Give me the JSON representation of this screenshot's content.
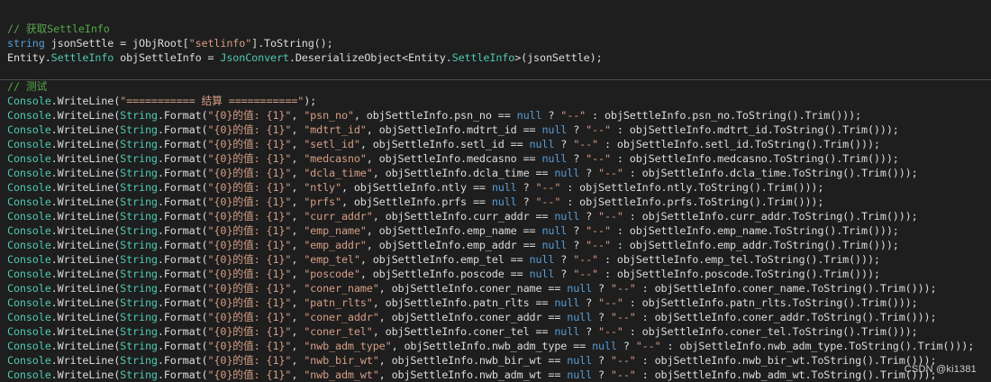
{
  "code_lines": [
    [
      [
        "comment",
        "// 获取SettleInfo"
      ]
    ],
    [
      [
        "kw",
        "string"
      ],
      [
        "plain",
        " jsonSettle = jObjRoot["
      ],
      [
        "str",
        "\"setlinfo\""
      ],
      [
        "plain",
        "].ToString();"
      ]
    ],
    [
      [
        "plain",
        "Entity."
      ],
      [
        "type",
        "SettleInfo"
      ],
      [
        "plain",
        " objSettleInfo = "
      ],
      [
        "type",
        "JsonConvert"
      ],
      [
        "plain",
        ".DeserializeObject<Entity."
      ],
      [
        "type",
        "SettleInfo"
      ],
      [
        "plain",
        ">(jsonSettle);"
      ]
    ],
    [
      [
        "plain",
        ""
      ]
    ],
    [
      [
        "comment",
        "// 测试"
      ]
    ],
    [
      [
        "type",
        "Console"
      ],
      [
        "plain",
        ".WriteLine("
      ],
      [
        "str",
        "\"=========== 结算 ===========\""
      ],
      [
        "plain",
        ");"
      ]
    ],
    [
      [
        "type",
        "Console"
      ],
      [
        "plain",
        ".WriteLine("
      ],
      [
        "type",
        "String"
      ],
      [
        "plain",
        ".Format("
      ],
      [
        "str",
        "\"{0}的值: {1}\""
      ],
      [
        "plain",
        ", "
      ],
      [
        "str",
        "\"psn_no\""
      ],
      [
        "plain",
        ", objSettleInfo.psn_no == "
      ],
      [
        "kw",
        "null"
      ],
      [
        "plain",
        " ? "
      ],
      [
        "str",
        "\"--\""
      ],
      [
        "plain",
        " : objSettleInfo.psn_no.ToString().Trim()));"
      ]
    ],
    [
      [
        "type",
        "Console"
      ],
      [
        "plain",
        ".WriteLine("
      ],
      [
        "type",
        "String"
      ],
      [
        "plain",
        ".Format("
      ],
      [
        "str",
        "\"{0}的值: {1}\""
      ],
      [
        "plain",
        ", "
      ],
      [
        "str",
        "\"mdtrt_id\""
      ],
      [
        "plain",
        ", objSettleInfo.mdtrt_id == "
      ],
      [
        "kw",
        "null"
      ],
      [
        "plain",
        " ? "
      ],
      [
        "str",
        "\"--\""
      ],
      [
        "plain",
        " : objSettleInfo.mdtrt_id.ToString().Trim()));"
      ]
    ],
    [
      [
        "type",
        "Console"
      ],
      [
        "plain",
        ".WriteLine("
      ],
      [
        "type",
        "String"
      ],
      [
        "plain",
        ".Format("
      ],
      [
        "str",
        "\"{0}的值: {1}\""
      ],
      [
        "plain",
        ", "
      ],
      [
        "str",
        "\"setl_id\""
      ],
      [
        "plain",
        ", objSettleInfo.setl_id == "
      ],
      [
        "kw",
        "null"
      ],
      [
        "plain",
        " ? "
      ],
      [
        "str",
        "\"--\""
      ],
      [
        "plain",
        " : objSettleInfo.setl_id.ToString().Trim()));"
      ]
    ],
    [
      [
        "type",
        "Console"
      ],
      [
        "plain",
        ".WriteLine("
      ],
      [
        "type",
        "String"
      ],
      [
        "plain",
        ".Format("
      ],
      [
        "str",
        "\"{0}的值: {1}\""
      ],
      [
        "plain",
        ", "
      ],
      [
        "str",
        "\"medcasno\""
      ],
      [
        "plain",
        ", objSettleInfo.medcasno == "
      ],
      [
        "kw",
        "null"
      ],
      [
        "plain",
        " ? "
      ],
      [
        "str",
        "\"--\""
      ],
      [
        "plain",
        " : objSettleInfo.medcasno.ToString().Trim()));"
      ]
    ],
    [
      [
        "type",
        "Console"
      ],
      [
        "plain",
        ".WriteLine("
      ],
      [
        "type",
        "String"
      ],
      [
        "plain",
        ".Format("
      ],
      [
        "str",
        "\"{0}的值: {1}\""
      ],
      [
        "plain",
        ", "
      ],
      [
        "str",
        "\"dcla_time\""
      ],
      [
        "plain",
        ", objSettleInfo.dcla_time == "
      ],
      [
        "kw",
        "null"
      ],
      [
        "plain",
        " ? "
      ],
      [
        "str",
        "\"--\""
      ],
      [
        "plain",
        " : objSettleInfo.dcla_time.ToString().Trim()));"
      ]
    ],
    [
      [
        "type",
        "Console"
      ],
      [
        "plain",
        ".WriteLine("
      ],
      [
        "type",
        "String"
      ],
      [
        "plain",
        ".Format("
      ],
      [
        "str",
        "\"{0}的值: {1}\""
      ],
      [
        "plain",
        ", "
      ],
      [
        "str",
        "\"ntly\""
      ],
      [
        "plain",
        ", objSettleInfo.ntly == "
      ],
      [
        "kw",
        "null"
      ],
      [
        "plain",
        " ? "
      ],
      [
        "str",
        "\"--\""
      ],
      [
        "plain",
        " : objSettleInfo.ntly.ToString().Trim()));"
      ]
    ],
    [
      [
        "type",
        "Console"
      ],
      [
        "plain",
        ".WriteLine("
      ],
      [
        "type",
        "String"
      ],
      [
        "plain",
        ".Format("
      ],
      [
        "str",
        "\"{0}的值: {1}\""
      ],
      [
        "plain",
        ", "
      ],
      [
        "str",
        "\"prfs\""
      ],
      [
        "plain",
        ", objSettleInfo.prfs == "
      ],
      [
        "kw",
        "null"
      ],
      [
        "plain",
        " ? "
      ],
      [
        "str",
        "\"--\""
      ],
      [
        "plain",
        " : objSettleInfo.prfs.ToString().Trim()));"
      ]
    ],
    [
      [
        "type",
        "Console"
      ],
      [
        "plain",
        ".WriteLine("
      ],
      [
        "type",
        "String"
      ],
      [
        "plain",
        ".Format("
      ],
      [
        "str",
        "\"{0}的值: {1}\""
      ],
      [
        "plain",
        ", "
      ],
      [
        "str",
        "\"curr_addr\""
      ],
      [
        "plain",
        ", objSettleInfo.curr_addr == "
      ],
      [
        "kw",
        "null"
      ],
      [
        "plain",
        " ? "
      ],
      [
        "str",
        "\"--\""
      ],
      [
        "plain",
        " : objSettleInfo.curr_addr.ToString().Trim()));"
      ]
    ],
    [
      [
        "type",
        "Console"
      ],
      [
        "plain",
        ".WriteLine("
      ],
      [
        "type",
        "String"
      ],
      [
        "plain",
        ".Format("
      ],
      [
        "str",
        "\"{0}的值: {1}\""
      ],
      [
        "plain",
        ", "
      ],
      [
        "str",
        "\"emp_name\""
      ],
      [
        "plain",
        ", objSettleInfo.emp_name == "
      ],
      [
        "kw",
        "null"
      ],
      [
        "plain",
        " ? "
      ],
      [
        "str",
        "\"--\""
      ],
      [
        "plain",
        " : objSettleInfo.emp_name.ToString().Trim()));"
      ]
    ],
    [
      [
        "type",
        "Console"
      ],
      [
        "plain",
        ".WriteLine("
      ],
      [
        "type",
        "String"
      ],
      [
        "plain",
        ".Format("
      ],
      [
        "str",
        "\"{0}的值: {1}\""
      ],
      [
        "plain",
        ", "
      ],
      [
        "str",
        "\"emp_addr\""
      ],
      [
        "plain",
        ", objSettleInfo.emp_addr == "
      ],
      [
        "kw",
        "null"
      ],
      [
        "plain",
        " ? "
      ],
      [
        "str",
        "\"--\""
      ],
      [
        "plain",
        " : objSettleInfo.emp_addr.ToString().Trim()));"
      ]
    ],
    [
      [
        "type",
        "Console"
      ],
      [
        "plain",
        ".WriteLine("
      ],
      [
        "type",
        "String"
      ],
      [
        "plain",
        ".Format("
      ],
      [
        "str",
        "\"{0}的值: {1}\""
      ],
      [
        "plain",
        ", "
      ],
      [
        "str",
        "\"emp_tel\""
      ],
      [
        "plain",
        ", objSettleInfo.emp_tel == "
      ],
      [
        "kw",
        "null"
      ],
      [
        "plain",
        " ? "
      ],
      [
        "str",
        "\"--\""
      ],
      [
        "plain",
        " : objSettleInfo.emp_tel.ToString().Trim()));"
      ]
    ],
    [
      [
        "type",
        "Console"
      ],
      [
        "plain",
        ".WriteLine("
      ],
      [
        "type",
        "String"
      ],
      [
        "plain",
        ".Format("
      ],
      [
        "str",
        "\"{0}的值: {1}\""
      ],
      [
        "plain",
        ", "
      ],
      [
        "str",
        "\"poscode\""
      ],
      [
        "plain",
        ", objSettleInfo.poscode == "
      ],
      [
        "kw",
        "null"
      ],
      [
        "plain",
        " ? "
      ],
      [
        "str",
        "\"--\""
      ],
      [
        "plain",
        " : objSettleInfo.poscode.ToString().Trim()));"
      ]
    ],
    [
      [
        "type",
        "Console"
      ],
      [
        "plain",
        ".WriteLine("
      ],
      [
        "type",
        "String"
      ],
      [
        "plain",
        ".Format("
      ],
      [
        "str",
        "\"{0}的值: {1}\""
      ],
      [
        "plain",
        ", "
      ],
      [
        "str",
        "\"coner_name\""
      ],
      [
        "plain",
        ", objSettleInfo.coner_name == "
      ],
      [
        "kw",
        "null"
      ],
      [
        "plain",
        " ? "
      ],
      [
        "str",
        "\"--\""
      ],
      [
        "plain",
        " : objSettleInfo.coner_name.ToString().Trim()));"
      ]
    ],
    [
      [
        "type",
        "Console"
      ],
      [
        "plain",
        ".WriteLine("
      ],
      [
        "type",
        "String"
      ],
      [
        "plain",
        ".Format("
      ],
      [
        "str",
        "\"{0}的值: {1}\""
      ],
      [
        "plain",
        ", "
      ],
      [
        "str",
        "\"patn_rlts\""
      ],
      [
        "plain",
        ", objSettleInfo.patn_rlts == "
      ],
      [
        "kw",
        "null"
      ],
      [
        "plain",
        " ? "
      ],
      [
        "str",
        "\"--\""
      ],
      [
        "plain",
        " : objSettleInfo.patn_rlts.ToString().Trim()));"
      ]
    ],
    [
      [
        "type",
        "Console"
      ],
      [
        "plain",
        ".WriteLine("
      ],
      [
        "type",
        "String"
      ],
      [
        "plain",
        ".Format("
      ],
      [
        "str",
        "\"{0}的值: {1}\""
      ],
      [
        "plain",
        ", "
      ],
      [
        "str",
        "\"coner_addr\""
      ],
      [
        "plain",
        ", objSettleInfo.coner_addr == "
      ],
      [
        "kw",
        "null"
      ],
      [
        "plain",
        " ? "
      ],
      [
        "str",
        "\"--\""
      ],
      [
        "plain",
        " : objSettleInfo.coner_addr.ToString().Trim()));"
      ]
    ],
    [
      [
        "type",
        "Console"
      ],
      [
        "plain",
        ".WriteLine("
      ],
      [
        "type",
        "String"
      ],
      [
        "plain",
        ".Format("
      ],
      [
        "str",
        "\"{0}的值: {1}\""
      ],
      [
        "plain",
        ", "
      ],
      [
        "str",
        "\"coner_tel\""
      ],
      [
        "plain",
        ", objSettleInfo.coner_tel == "
      ],
      [
        "kw",
        "null"
      ],
      [
        "plain",
        " ? "
      ],
      [
        "str",
        "\"--\""
      ],
      [
        "plain",
        " : objSettleInfo.coner_tel.ToString().Trim()));"
      ]
    ],
    [
      [
        "type",
        "Console"
      ],
      [
        "plain",
        ".WriteLine("
      ],
      [
        "type",
        "String"
      ],
      [
        "plain",
        ".Format("
      ],
      [
        "str",
        "\"{0}的值: {1}\""
      ],
      [
        "plain",
        ", "
      ],
      [
        "str",
        "\"nwb_adm_type\""
      ],
      [
        "plain",
        ", objSettleInfo.nwb_adm_type == "
      ],
      [
        "kw",
        "null"
      ],
      [
        "plain",
        " ? "
      ],
      [
        "str",
        "\"--\""
      ],
      [
        "plain",
        " : objSettleInfo.nwb_adm_type.ToString().Trim()));"
      ]
    ],
    [
      [
        "type",
        "Console"
      ],
      [
        "plain",
        ".WriteLine("
      ],
      [
        "type",
        "String"
      ],
      [
        "plain",
        ".Format("
      ],
      [
        "str",
        "\"{0}的值: {1}\""
      ],
      [
        "plain",
        ", "
      ],
      [
        "str",
        "\"nwb_bir_wt\""
      ],
      [
        "plain",
        ", objSettleInfo.nwb_bir_wt == "
      ],
      [
        "kw",
        "null"
      ],
      [
        "plain",
        " ? "
      ],
      [
        "str",
        "\"--\""
      ],
      [
        "plain",
        " : objSettleInfo.nwb_bir_wt.ToString().Trim()));"
      ]
    ],
    [
      [
        "type",
        "Console"
      ],
      [
        "plain",
        ".WriteLine("
      ],
      [
        "type",
        "String"
      ],
      [
        "plain",
        ".Format("
      ],
      [
        "str",
        "\"{0}的值: {1}\""
      ],
      [
        "plain",
        ", "
      ],
      [
        "str",
        "\"nwb_adm_wt\""
      ],
      [
        "plain",
        ", objSettleInfo.nwb_adm_wt == "
      ],
      [
        "kw",
        "null"
      ],
      [
        "plain",
        " ? "
      ],
      [
        "str",
        "\"--\""
      ],
      [
        "plain",
        " : objSettleInfo.nwb_adm_wt.ToString().Trim()));"
      ]
    ]
  ],
  "watermark": "CSDN @ki1381",
  "colors": {
    "background": "#1e1e1e",
    "comment": "#57a64a",
    "keyword": "#569cd6",
    "type": "#4ec9b0",
    "string": "#d69d85",
    "plain": "#dcdcdc"
  }
}
